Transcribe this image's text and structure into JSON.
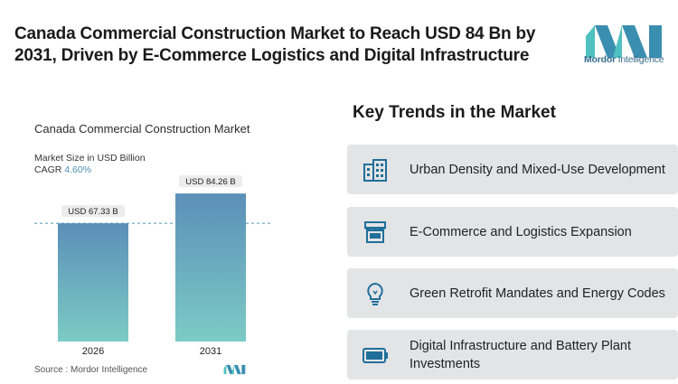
{
  "headline": "Canada Commercial Construction Market to Reach USD 84 Bn by 2031, Driven by E-Commerce Logistics and Digital Infrastructure",
  "brand": {
    "name_bold": "Mordor",
    "name_rest": " Intelligence",
    "color": "#3a8fb0"
  },
  "chart": {
    "title": "Canada Commercial Construction Market",
    "subtitle": "Market Size in USD Billion",
    "cagr_label": "CAGR",
    "cagr_value": "4.60%",
    "source": "Source :  Mordor Intelligence"
  },
  "chart_data": {
    "type": "bar",
    "categories": [
      "2026",
      "2031"
    ],
    "values": [
      67.33,
      84.26
    ],
    "data_labels": [
      "USD 67.33 B",
      "USD 84.26 B"
    ],
    "title": "Canada Commercial Construction Market",
    "ylabel": "Market Size in USD Billion",
    "ylim": [
      0,
      90
    ],
    "grid": false,
    "colors": {
      "bar_top": "#5b8fb8",
      "bar_bottom": "#7ccbc5",
      "reference_line": "#4f97ad"
    }
  },
  "trends": {
    "title": "Key Trends in the Market",
    "items": [
      {
        "label": "Urban Density and Mixed-Use Development",
        "icon": "buildings-icon"
      },
      {
        "label": "E-Commerce and Logistics Expansion",
        "icon": "storefront-icon"
      },
      {
        "label": "Green Retrofit Mandates and Energy Codes",
        "icon": "lightbulb-icon"
      },
      {
        "label": "Digital Infrastructure and Battery Plant Investments",
        "icon": "battery-icon"
      }
    ],
    "icon_color": "#1f6f9a"
  }
}
